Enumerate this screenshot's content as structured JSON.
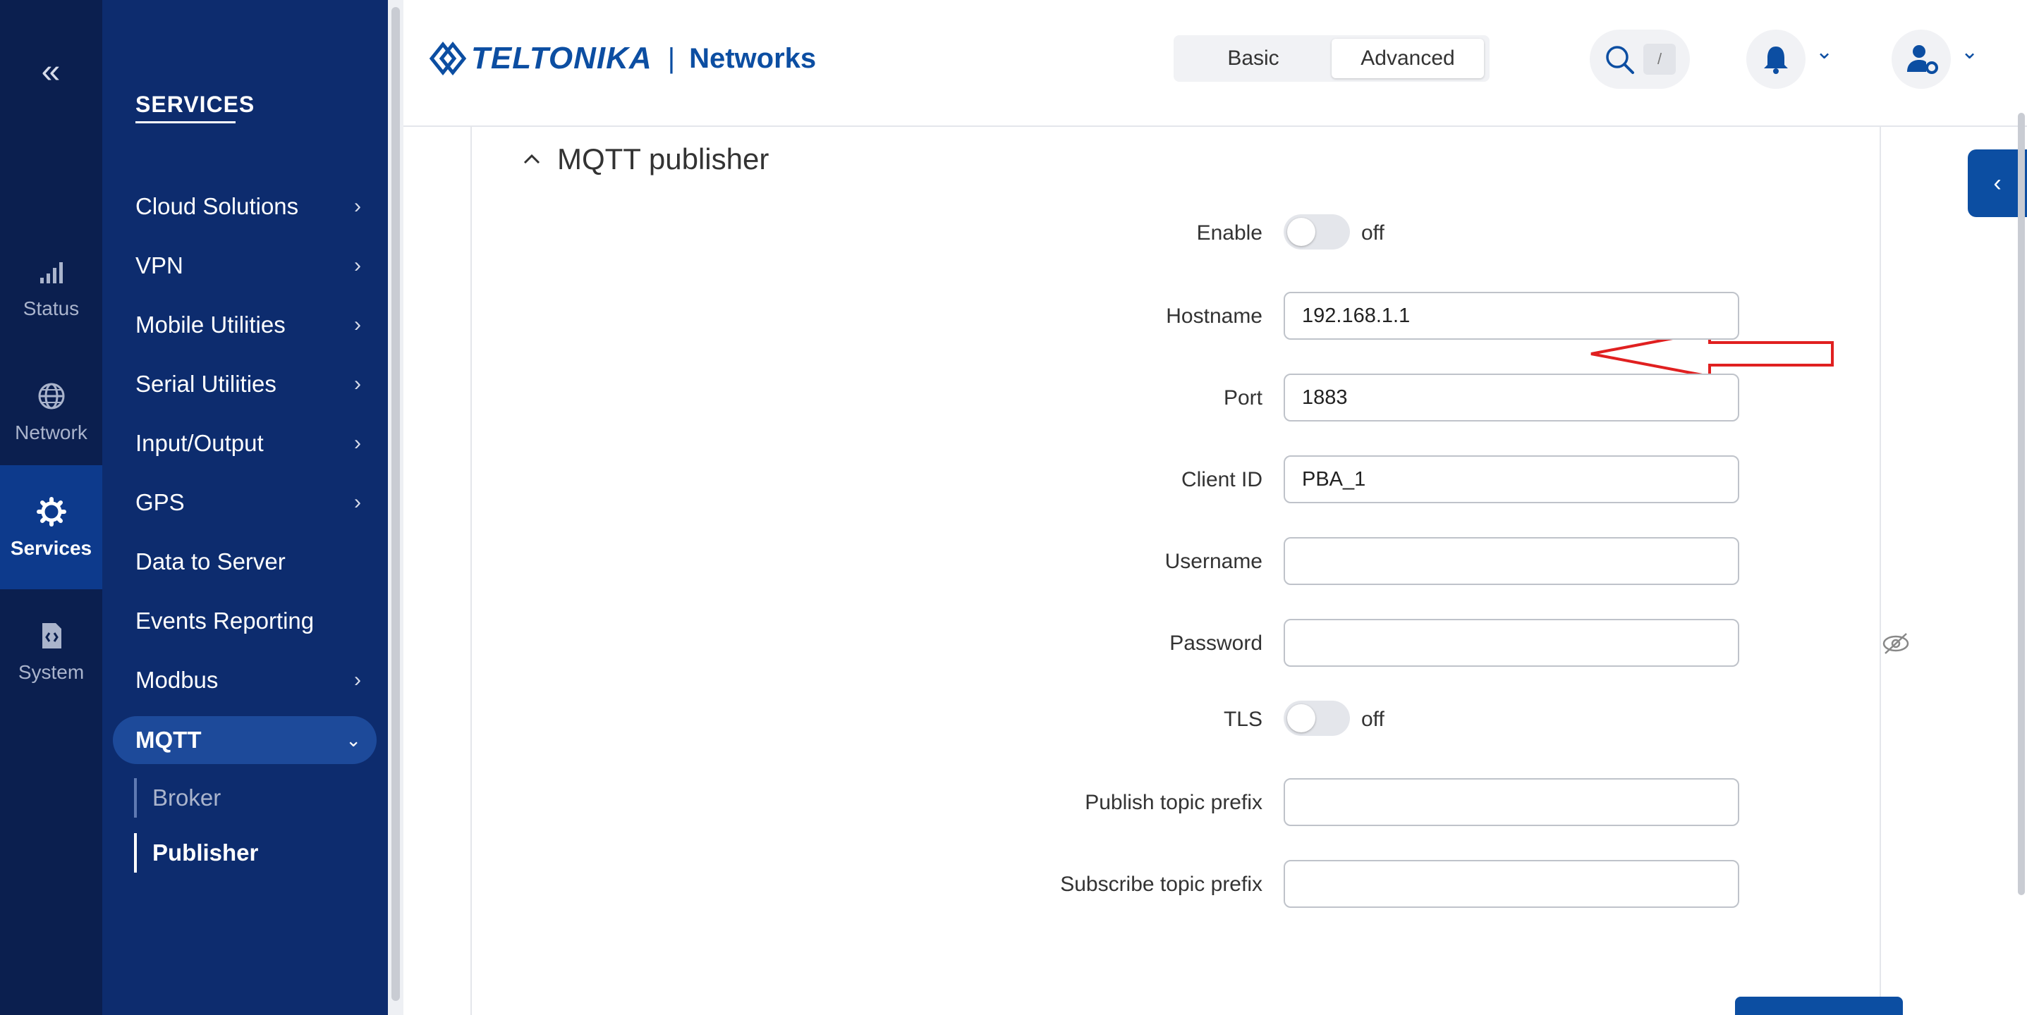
{
  "rail": {
    "items": [
      {
        "label": "Status",
        "icon": "signal-icon"
      },
      {
        "label": "Network",
        "icon": "globe-icon"
      },
      {
        "label": "Services",
        "icon": "gear-icon",
        "active": true
      },
      {
        "label": "System",
        "icon": "system-icon"
      }
    ]
  },
  "menu": {
    "title": "SERVICES",
    "items": [
      {
        "label": "Cloud Solutions",
        "chevron": true
      },
      {
        "label": "VPN",
        "chevron": true
      },
      {
        "label": "Mobile Utilities",
        "chevron": true
      },
      {
        "label": "Serial Utilities",
        "chevron": true
      },
      {
        "label": "Input/Output",
        "chevron": true
      },
      {
        "label": "GPS",
        "chevron": true
      },
      {
        "label": "Data to Server",
        "chevron": false
      },
      {
        "label": "Events Reporting",
        "chevron": false
      },
      {
        "label": "Modbus",
        "chevron": true
      }
    ],
    "active_item": "MQTT",
    "submenu": [
      {
        "label": "Broker",
        "active": false
      },
      {
        "label": "Publisher",
        "active": true
      }
    ]
  },
  "header": {
    "brand": "TELTONIKA",
    "separator": "|",
    "brand_sub": "Networks",
    "mode_basic": "Basic",
    "mode_advanced": "Advanced",
    "mode_selected": "Advanced",
    "search_shortcut": "/"
  },
  "section": {
    "title": "MQTT publisher"
  },
  "form": {
    "enable_label": "Enable",
    "enable_state": "off",
    "hostname_label": "Hostname",
    "hostname_value": "192.168.1.1",
    "port_label": "Port",
    "port_value": "1883",
    "client_id_label": "Client ID",
    "client_id_value": "PBA_1",
    "username_label": "Username",
    "username_value": "",
    "password_label": "Password",
    "password_value": "",
    "tls_label": "TLS",
    "tls_state": "off",
    "publish_prefix_label": "Publish topic prefix",
    "publish_prefix_value": "",
    "subscribe_prefix_label": "Subscribe topic prefix",
    "subscribe_prefix_value": ""
  },
  "colors": {
    "rail_bg": "#0b1f4f",
    "menu_bg": "#0d2c6e",
    "accent": "#0c4ea2",
    "annotation_arrow": "#e02020"
  }
}
